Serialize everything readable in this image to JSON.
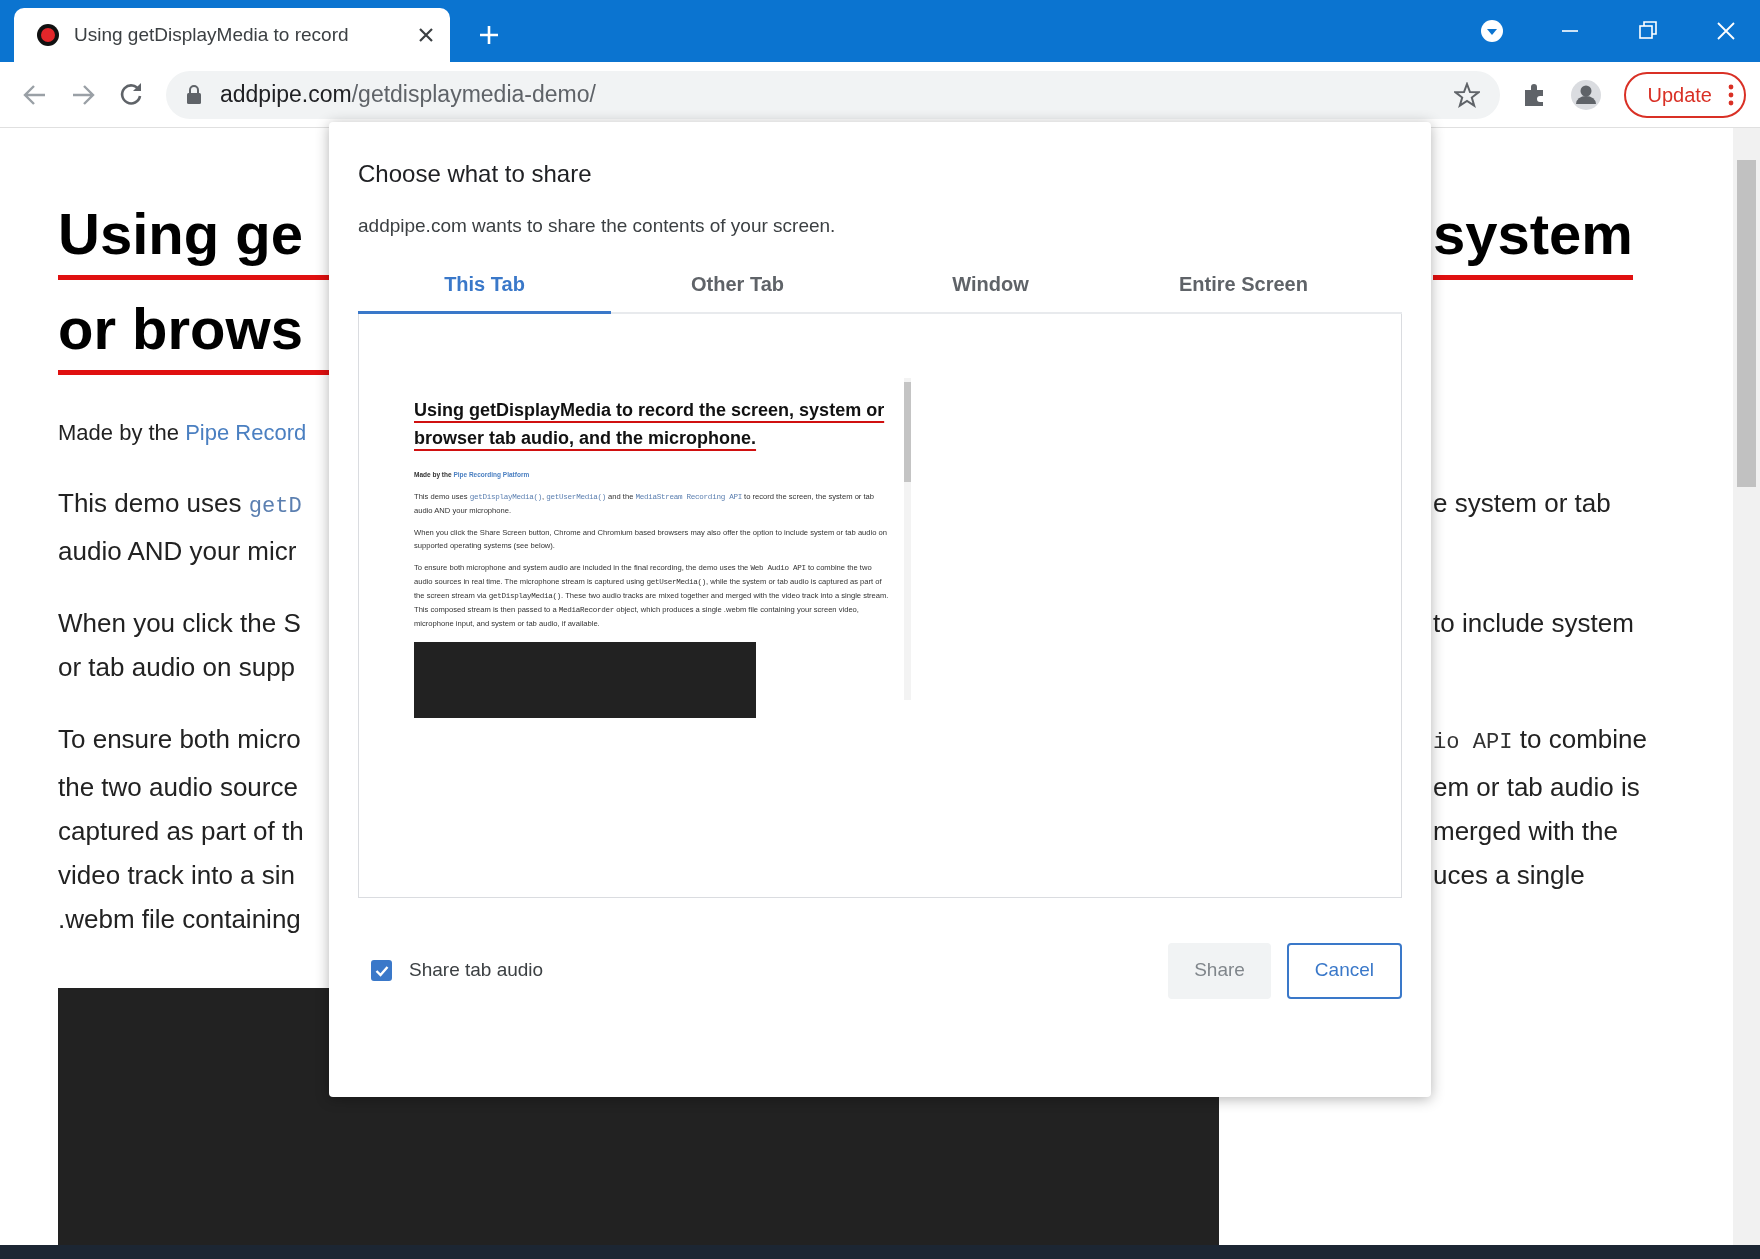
{
  "browser": {
    "tab_title": "Using getDisplayMedia to record",
    "address": {
      "domain": "addpipe.com",
      "path": "/getdisplaymedia-demo/"
    },
    "update_button": "Update"
  },
  "page": {
    "paragraphs": [
      {
        "kind": "heading",
        "lines": [
          {
            "left": [
              {
                "kind": "plain",
                "text": "Using ge"
              }
            ],
            "right": [
              {
                "kind": "plain",
                "text": "system"
              }
            ]
          },
          {
            "left": [
              {
                "kind": "plain",
                "text": "or brows"
              }
            ]
          }
        ]
      },
      {
        "kind": "byline",
        "lines": [
          {
            "left": [
              {
                "kind": "plain",
                "text": "Made by the "
              },
              {
                "kind": "link",
                "text": "Pipe Record"
              }
            ]
          }
        ]
      },
      {
        "kind": "body",
        "lines": [
          {
            "left": [
              {
                "kind": "plain",
                "text": "This demo uses "
              },
              {
                "kind": "code_link",
                "text": "getD"
              }
            ],
            "right": [
              {
                "kind": "plain",
                "text": "e system or tab"
              }
            ]
          },
          {
            "left": [
              {
                "kind": "plain",
                "text": "audio AND your micr"
              }
            ]
          }
        ]
      },
      {
        "kind": "body",
        "lines": [
          {
            "left": [
              {
                "kind": "plain",
                "text": "When you click the S"
              }
            ],
            "right": [
              {
                "kind": "plain",
                "text": " to include system"
              }
            ]
          },
          {
            "left": [
              {
                "kind": "plain",
                "text": "or tab audio on supp"
              }
            ]
          }
        ]
      },
      {
        "kind": "body",
        "lines": [
          {
            "left": [
              {
                "kind": "plain",
                "text": "To ensure both micro"
              }
            ],
            "right": [
              {
                "kind": "code",
                "text": "io API"
              },
              {
                "kind": "plain",
                "text": " to combine"
              }
            ]
          },
          {
            "left": [
              {
                "kind": "plain",
                "text": "the two audio source"
              }
            ],
            "right": [
              {
                "kind": "plain",
                "text": "em or tab audio is"
              }
            ]
          },
          {
            "left": [
              {
                "kind": "plain",
                "text": "captured as part of th"
              }
            ],
            "right": [
              {
                "kind": "plain",
                "text": " merged with the"
              }
            ]
          },
          {
            "left": [
              {
                "kind": "plain",
                "text": "video track into a sin"
              }
            ],
            "right": [
              {
                "kind": "plain",
                "text": "uces a single"
              }
            ]
          },
          {
            "left": [
              {
                "kind": "plain",
                "text": ".webm file containing"
              }
            ]
          }
        ]
      }
    ]
  },
  "dialog": {
    "title": "Choose what to share",
    "subtitle": "addpipe.com wants to share the contents of your screen.",
    "tabs": [
      {
        "label": "This Tab",
        "selected": true
      },
      {
        "label": "Other Tab",
        "selected": false
      },
      {
        "label": "Window",
        "selected": false
      },
      {
        "label": "Entire Screen",
        "selected": false
      }
    ],
    "preview": {
      "heading": "Using getDisplayMedia to record the screen, system or browser tab audio, and the microphone.",
      "paragraphs": [
        {
          "kind": "byline",
          "segments": [
            {
              "kind": "plain",
              "text": "Made by the "
            },
            {
              "kind": "link",
              "text": "Pipe Recording Platform"
            }
          ]
        },
        {
          "kind": "body",
          "segments": [
            {
              "kind": "plain",
              "text": "This demo uses "
            },
            {
              "kind": "code_link",
              "text": "getDisplayMedia()"
            },
            {
              "kind": "plain",
              "text": ", "
            },
            {
              "kind": "code_link",
              "text": "getUserMedia()"
            },
            {
              "kind": "plain",
              "text": " and the "
            },
            {
              "kind": "code_link",
              "text": "MediaStream Recording API"
            },
            {
              "kind": "plain",
              "text": " to record the screen, the system or tab audio AND your microphone."
            }
          ]
        },
        {
          "kind": "body",
          "segments": [
            {
              "kind": "plain",
              "text": "When you click the Share Screen button, Chrome and Chromium based browsers may also offer the option to include system or tab audio on supported operating systems (see below)."
            }
          ]
        },
        {
          "kind": "body",
          "segments": [
            {
              "kind": "plain",
              "text": "To ensure both microphone and system audio are included in the final recording, the demo uses the "
            },
            {
              "kind": "code",
              "text": "Web Audio API"
            },
            {
              "kind": "plain",
              "text": " to combine the two audio sources in real time. The microphone stream is captured using "
            },
            {
              "kind": "code",
              "text": "getUserMedia()"
            },
            {
              "kind": "plain",
              "text": ", while the system or tab audio is captured as part of the screen stream via "
            },
            {
              "kind": "code",
              "text": "getDisplayMedia()"
            },
            {
              "kind": "plain",
              "text": ". These two audio tracks are mixed together and merged with the video track into a single stream. This composed stream is then passed to a "
            },
            {
              "kind": "code",
              "text": "MediaRecorder"
            },
            {
              "kind": "plain",
              "text": " object, which produces a single .webm file containing your screen video, microphone input, and system or tab audio, if available."
            }
          ]
        }
      ]
    },
    "audio_checkbox": {
      "label": "Share tab audio",
      "checked": true
    },
    "buttons": [
      {
        "label": "Share",
        "kind": "share",
        "disabled": true
      },
      {
        "label": "Cancel",
        "kind": "cancel",
        "disabled": false
      }
    ]
  }
}
